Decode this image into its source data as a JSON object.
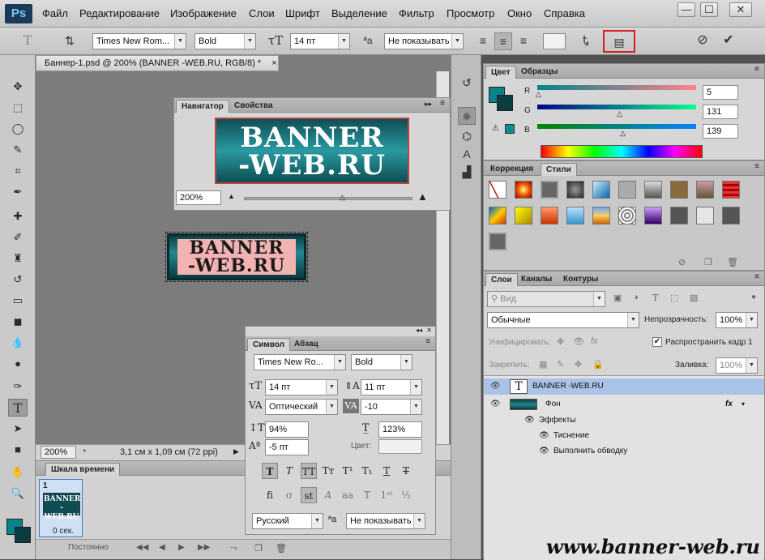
{
  "app": {
    "logo": "Ps"
  },
  "menu": [
    "Файл",
    "Редактирование",
    "Изображение",
    "Слои",
    "Шрифт",
    "Выделение",
    "Фильтр",
    "Просмотр",
    "Окно",
    "Справка"
  ],
  "window_controls": {
    "minimize": "—",
    "maximize": "☐",
    "close": "✕"
  },
  "options": {
    "font_family": "Times New Rom...",
    "font_style": "Bold",
    "font_size": "14 пт",
    "antialias": "Не показывать"
  },
  "document": {
    "tab_title": "Баннер-1.psd @ 200% (BANNER -WEB.RU, RGB/8) *",
    "zoom": "200%",
    "size_info": "3,1 см x 1,09 см (72 ppi)",
    "banner_text_line1": "BANNER",
    "banner_text_line2": "-WEB.RU"
  },
  "navigator": {
    "tab_navigator": "Навигатор",
    "tab_properties": "Свойства",
    "zoom": "200%",
    "line1": "BANNER",
    "line2": "-WEB.RU"
  },
  "character": {
    "tab_symbol": "Символ",
    "tab_paragraph": "Абзац",
    "font_family": "Times New Ro...",
    "font_style": "Bold",
    "font_size": "14 пт",
    "leading": "11 пт",
    "kerning": "Оптический",
    "tracking": "-10",
    "vscale": "94%",
    "hscale": "123%",
    "baseline": "-5 пт",
    "color_label": "Цвет:",
    "language": "Русский",
    "antialias": "Не показывать"
  },
  "color_panel": {
    "tab_color": "Цвет",
    "tab_swatches": "Образцы",
    "r_label": "R",
    "g_label": "G",
    "b_label": "B",
    "r": "5",
    "g": "131",
    "b": "139",
    "fg_color": "#05838b",
    "bg_color": "#0a3c40"
  },
  "styles_panel": {
    "tab_correction": "Коррекция",
    "tab_styles": "Стили"
  },
  "layers_panel": {
    "tab_layers": "Слои",
    "tab_channels": "Каналы",
    "tab_paths": "Контуры",
    "kind": "Вид",
    "blend": "Обычные",
    "opacity_label": "Непрозрачность:",
    "opacity": "100%",
    "unify_label": "Унифицировать:",
    "propagate_label": "Распространить кадр 1",
    "lock_label": "Закрепить:",
    "fill_label": "Заливка:",
    "fill": "100%",
    "layers": [
      {
        "name": "BANNER -WEB.RU"
      },
      {
        "name": "Фон",
        "fx": "fx"
      },
      {
        "name": "Эффекты"
      },
      {
        "name": "Тиснение"
      },
      {
        "name": "Выполнить обводку"
      }
    ]
  },
  "timeline": {
    "title": "Шкала времени",
    "frame_number": "1",
    "frame_delay": "0 сек.",
    "loop": "Постоянно",
    "thumb_line1": "BANNER",
    "thumb_line2": "-WEB.RU"
  },
  "watermark": "www.banner-web.ru"
}
